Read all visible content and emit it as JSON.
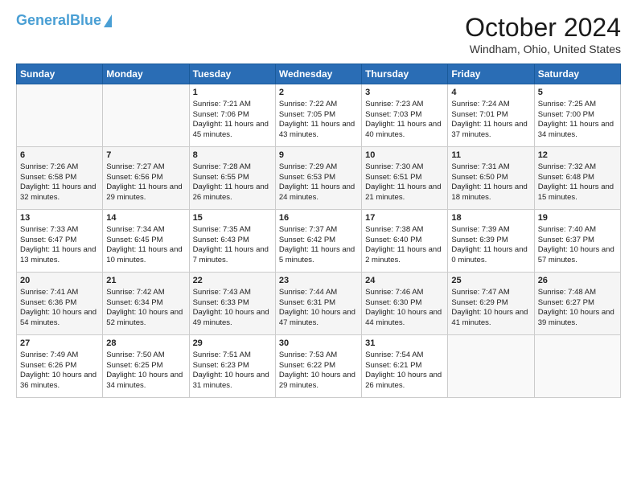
{
  "header": {
    "logo_line1": "General",
    "logo_line2": "Blue",
    "month": "October 2024",
    "location": "Windham, Ohio, United States"
  },
  "days_of_week": [
    "Sunday",
    "Monday",
    "Tuesday",
    "Wednesday",
    "Thursday",
    "Friday",
    "Saturday"
  ],
  "weeks": [
    [
      {
        "day": "",
        "sunrise": "",
        "sunset": "",
        "daylight": ""
      },
      {
        "day": "",
        "sunrise": "",
        "sunset": "",
        "daylight": ""
      },
      {
        "day": "1",
        "sunrise": "Sunrise: 7:21 AM",
        "sunset": "Sunset: 7:06 PM",
        "daylight": "Daylight: 11 hours and 45 minutes."
      },
      {
        "day": "2",
        "sunrise": "Sunrise: 7:22 AM",
        "sunset": "Sunset: 7:05 PM",
        "daylight": "Daylight: 11 hours and 43 minutes."
      },
      {
        "day": "3",
        "sunrise": "Sunrise: 7:23 AM",
        "sunset": "Sunset: 7:03 PM",
        "daylight": "Daylight: 11 hours and 40 minutes."
      },
      {
        "day": "4",
        "sunrise": "Sunrise: 7:24 AM",
        "sunset": "Sunset: 7:01 PM",
        "daylight": "Daylight: 11 hours and 37 minutes."
      },
      {
        "day": "5",
        "sunrise": "Sunrise: 7:25 AM",
        "sunset": "Sunset: 7:00 PM",
        "daylight": "Daylight: 11 hours and 34 minutes."
      }
    ],
    [
      {
        "day": "6",
        "sunrise": "Sunrise: 7:26 AM",
        "sunset": "Sunset: 6:58 PM",
        "daylight": "Daylight: 11 hours and 32 minutes."
      },
      {
        "day": "7",
        "sunrise": "Sunrise: 7:27 AM",
        "sunset": "Sunset: 6:56 PM",
        "daylight": "Daylight: 11 hours and 29 minutes."
      },
      {
        "day": "8",
        "sunrise": "Sunrise: 7:28 AM",
        "sunset": "Sunset: 6:55 PM",
        "daylight": "Daylight: 11 hours and 26 minutes."
      },
      {
        "day": "9",
        "sunrise": "Sunrise: 7:29 AM",
        "sunset": "Sunset: 6:53 PM",
        "daylight": "Daylight: 11 hours and 24 minutes."
      },
      {
        "day": "10",
        "sunrise": "Sunrise: 7:30 AM",
        "sunset": "Sunset: 6:51 PM",
        "daylight": "Daylight: 11 hours and 21 minutes."
      },
      {
        "day": "11",
        "sunrise": "Sunrise: 7:31 AM",
        "sunset": "Sunset: 6:50 PM",
        "daylight": "Daylight: 11 hours and 18 minutes."
      },
      {
        "day": "12",
        "sunrise": "Sunrise: 7:32 AM",
        "sunset": "Sunset: 6:48 PM",
        "daylight": "Daylight: 11 hours and 15 minutes."
      }
    ],
    [
      {
        "day": "13",
        "sunrise": "Sunrise: 7:33 AM",
        "sunset": "Sunset: 6:47 PM",
        "daylight": "Daylight: 11 hours and 13 minutes."
      },
      {
        "day": "14",
        "sunrise": "Sunrise: 7:34 AM",
        "sunset": "Sunset: 6:45 PM",
        "daylight": "Daylight: 11 hours and 10 minutes."
      },
      {
        "day": "15",
        "sunrise": "Sunrise: 7:35 AM",
        "sunset": "Sunset: 6:43 PM",
        "daylight": "Daylight: 11 hours and 7 minutes."
      },
      {
        "day": "16",
        "sunrise": "Sunrise: 7:37 AM",
        "sunset": "Sunset: 6:42 PM",
        "daylight": "Daylight: 11 hours and 5 minutes."
      },
      {
        "day": "17",
        "sunrise": "Sunrise: 7:38 AM",
        "sunset": "Sunset: 6:40 PM",
        "daylight": "Daylight: 11 hours and 2 minutes."
      },
      {
        "day": "18",
        "sunrise": "Sunrise: 7:39 AM",
        "sunset": "Sunset: 6:39 PM",
        "daylight": "Daylight: 11 hours and 0 minutes."
      },
      {
        "day": "19",
        "sunrise": "Sunrise: 7:40 AM",
        "sunset": "Sunset: 6:37 PM",
        "daylight": "Daylight: 10 hours and 57 minutes."
      }
    ],
    [
      {
        "day": "20",
        "sunrise": "Sunrise: 7:41 AM",
        "sunset": "Sunset: 6:36 PM",
        "daylight": "Daylight: 10 hours and 54 minutes."
      },
      {
        "day": "21",
        "sunrise": "Sunrise: 7:42 AM",
        "sunset": "Sunset: 6:34 PM",
        "daylight": "Daylight: 10 hours and 52 minutes."
      },
      {
        "day": "22",
        "sunrise": "Sunrise: 7:43 AM",
        "sunset": "Sunset: 6:33 PM",
        "daylight": "Daylight: 10 hours and 49 minutes."
      },
      {
        "day": "23",
        "sunrise": "Sunrise: 7:44 AM",
        "sunset": "Sunset: 6:31 PM",
        "daylight": "Daylight: 10 hours and 47 minutes."
      },
      {
        "day": "24",
        "sunrise": "Sunrise: 7:46 AM",
        "sunset": "Sunset: 6:30 PM",
        "daylight": "Daylight: 10 hours and 44 minutes."
      },
      {
        "day": "25",
        "sunrise": "Sunrise: 7:47 AM",
        "sunset": "Sunset: 6:29 PM",
        "daylight": "Daylight: 10 hours and 41 minutes."
      },
      {
        "day": "26",
        "sunrise": "Sunrise: 7:48 AM",
        "sunset": "Sunset: 6:27 PM",
        "daylight": "Daylight: 10 hours and 39 minutes."
      }
    ],
    [
      {
        "day": "27",
        "sunrise": "Sunrise: 7:49 AM",
        "sunset": "Sunset: 6:26 PM",
        "daylight": "Daylight: 10 hours and 36 minutes."
      },
      {
        "day": "28",
        "sunrise": "Sunrise: 7:50 AM",
        "sunset": "Sunset: 6:25 PM",
        "daylight": "Daylight: 10 hours and 34 minutes."
      },
      {
        "day": "29",
        "sunrise": "Sunrise: 7:51 AM",
        "sunset": "Sunset: 6:23 PM",
        "daylight": "Daylight: 10 hours and 31 minutes."
      },
      {
        "day": "30",
        "sunrise": "Sunrise: 7:53 AM",
        "sunset": "Sunset: 6:22 PM",
        "daylight": "Daylight: 10 hours and 29 minutes."
      },
      {
        "day": "31",
        "sunrise": "Sunrise: 7:54 AM",
        "sunset": "Sunset: 6:21 PM",
        "daylight": "Daylight: 10 hours and 26 minutes."
      },
      {
        "day": "",
        "sunrise": "",
        "sunset": "",
        "daylight": ""
      },
      {
        "day": "",
        "sunrise": "",
        "sunset": "",
        "daylight": ""
      }
    ]
  ]
}
